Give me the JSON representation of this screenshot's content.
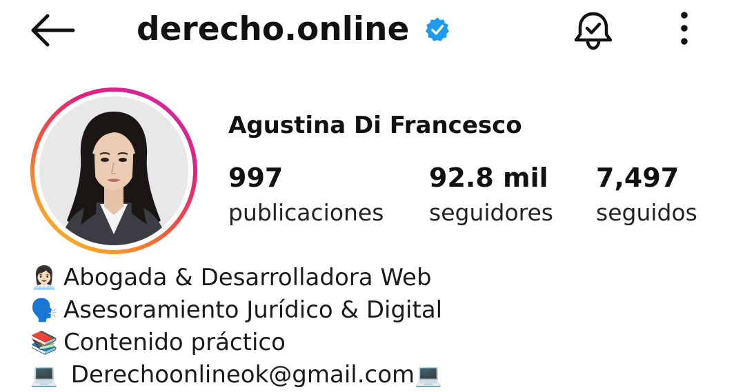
{
  "header": {
    "username": "derecho.online",
    "verified": true,
    "accent_color": "#1d9bf0"
  },
  "icons": {
    "back": "arrow-left-icon",
    "verified": "verified-badge-icon",
    "notifications": "bell-check-icon",
    "more": "more-vertical-icon"
  },
  "profile": {
    "full_name": "Agustina Di Francesco",
    "avatar_alt": "profile-photo",
    "stats": [
      {
        "value": "997",
        "label": "publicaciones"
      },
      {
        "value": "92.8 mil",
        "label": "seguidores"
      },
      {
        "value": "7,497",
        "label": "seguidos"
      }
    ]
  },
  "bio": {
    "lines": [
      {
        "emoji": "👩🏻‍💼",
        "text": "Abogada & Desarrolladora Web"
      },
      {
        "emoji": "🗣️",
        "text": "Asesoramiento Jurídico & Digital"
      },
      {
        "emoji": "📚",
        "text": "Contenido práctico"
      },
      {
        "emoji": "💻",
        "text": " Derechoonlineok@gmail.com",
        "emoji_after": "💻"
      }
    ]
  }
}
